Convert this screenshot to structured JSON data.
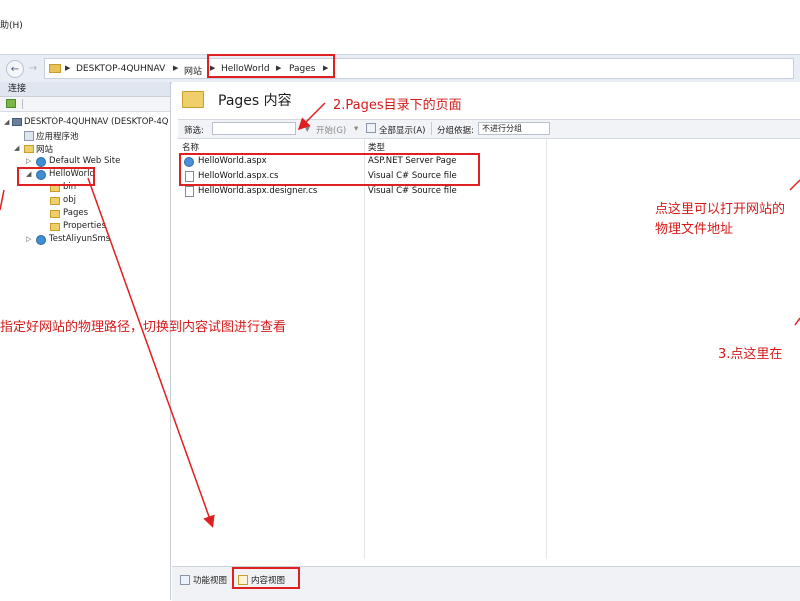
{
  "menu": {
    "help_fragment": "助(H)"
  },
  "address_bar": {
    "crumbs": [
      "DESKTOP-4QUHNAV",
      "网站",
      "HelloWorld",
      "Pages"
    ]
  },
  "left_panel": {
    "header": "连接",
    "tree": [
      {
        "label": "DESKTOP-4QUHNAV (DESKTOP-4Q",
        "icon": "computer-icon"
      },
      {
        "label": "应用程序池",
        "icon": "app-pool-icon"
      },
      {
        "label": "网站",
        "icon": "folder-icon"
      },
      {
        "label": "Default Web Site",
        "icon": "globe-icon"
      },
      {
        "label": "HelloWorld",
        "icon": "globe-icon"
      },
      {
        "label": "bin",
        "icon": "folder-icon"
      },
      {
        "label": "obj",
        "icon": "folder-icon"
      },
      {
        "label": "Pages",
        "icon": "folder-icon"
      },
      {
        "label": "Properties",
        "icon": "folder-icon"
      },
      {
        "label": "TestAliyunSms",
        "icon": "globe-icon"
      }
    ]
  },
  "main": {
    "title": "Pages 内容",
    "filter": {
      "label": "筛选:",
      "value": "",
      "start_label": "开始(G)",
      "show_all_label": "全部显示(A)",
      "group_label": "分组依据:",
      "group_value": "不进行分组"
    },
    "columns": [
      "名称",
      "类型"
    ],
    "rows": [
      {
        "name": "HelloWorld.aspx",
        "type": "ASP.NET Server Page",
        "icon": "aspx-page-icon"
      },
      {
        "name": "HelloWorld.aspx.cs",
        "type": "Visual C# Source file",
        "icon": "cs-file-icon"
      },
      {
        "name": "HelloWorld.aspx.designer.cs",
        "type": "Visual C# Source file",
        "icon": "cs-file-icon"
      }
    ],
    "bottom_tabs": [
      "功能视图",
      "内容视图"
    ]
  },
  "annotations": {
    "pages_dir": "2.Pages目录下的页面",
    "physical_path": "指定好网站的物理路径，切换到内容试图进行查看",
    "open_physical_1": "点这里可以打开网站的",
    "open_physical_2": "物理文件地址",
    "click_here_3": "3.点这里在"
  },
  "colors": {
    "annotation_red": "#e02020",
    "address_bar_bg": "#e9eef6"
  }
}
